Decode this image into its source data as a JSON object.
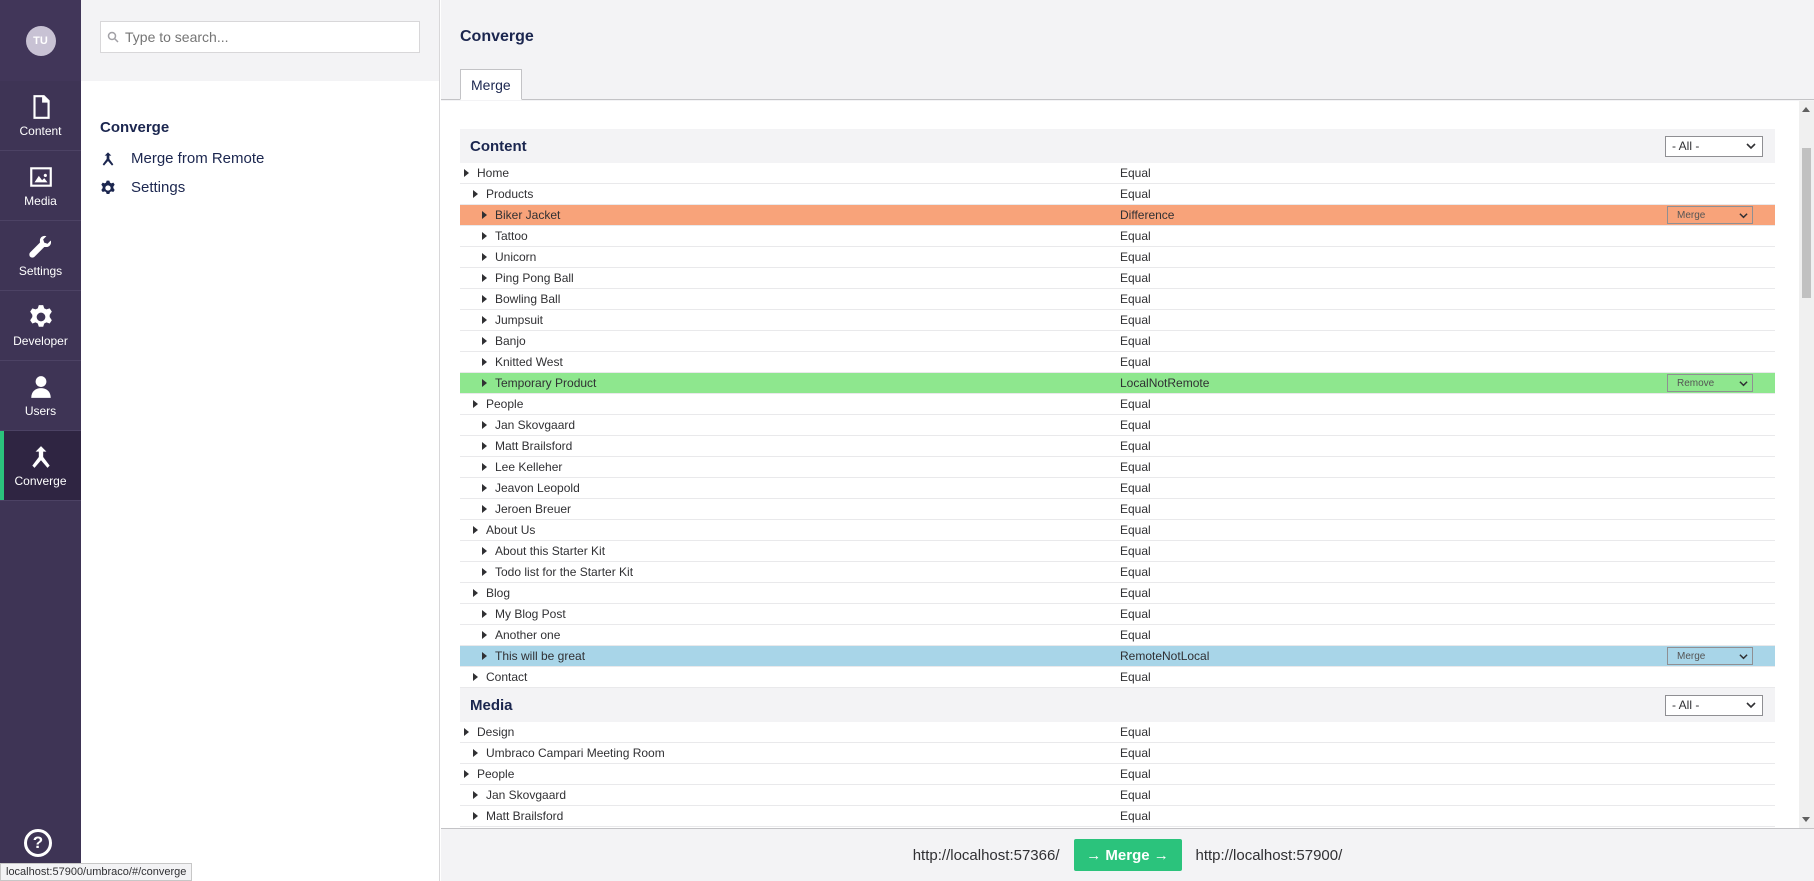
{
  "user": {
    "initials": "TU"
  },
  "nav": {
    "items": [
      {
        "label": "Content",
        "icon": "document-icon"
      },
      {
        "label": "Media",
        "icon": "image-icon"
      },
      {
        "label": "Settings",
        "icon": "wrench-icon"
      },
      {
        "label": "Developer",
        "icon": "gear-icon"
      },
      {
        "label": "Users",
        "icon": "user-icon"
      },
      {
        "label": "Converge",
        "icon": "merge-icon"
      }
    ],
    "help_label": "?"
  },
  "tree": {
    "search_placeholder": "Type to search...",
    "title": "Converge",
    "items": [
      {
        "label": "Merge from Remote",
        "icon": "merge-icon"
      },
      {
        "label": "Settings",
        "icon": "gear-icon"
      }
    ]
  },
  "header": {
    "title": "Converge",
    "tab": "Merge"
  },
  "sections": {
    "content": {
      "name": "Content",
      "filter": "- All -",
      "rows": [
        {
          "name": "Home",
          "status": "Equal"
        },
        {
          "name": "Products",
          "status": "Equal"
        },
        {
          "name": "Biker Jacket",
          "status": "Difference",
          "action": "Merge"
        },
        {
          "name": "Tattoo",
          "status": "Equal"
        },
        {
          "name": "Unicorn",
          "status": "Equal"
        },
        {
          "name": "Ping Pong Ball",
          "status": "Equal"
        },
        {
          "name": "Bowling Ball",
          "status": "Equal"
        },
        {
          "name": "Jumpsuit",
          "status": "Equal"
        },
        {
          "name": "Banjo",
          "status": "Equal"
        },
        {
          "name": "Knitted West",
          "status": "Equal"
        },
        {
          "name": "Temporary Product",
          "status": "LocalNotRemote",
          "action": "Remove"
        },
        {
          "name": "People",
          "status": "Equal"
        },
        {
          "name": "Jan Skovgaard",
          "status": "Equal"
        },
        {
          "name": "Matt Brailsford",
          "status": "Equal"
        },
        {
          "name": "Lee Kelleher",
          "status": "Equal"
        },
        {
          "name": "Jeavon Leopold",
          "status": "Equal"
        },
        {
          "name": "Jeroen Breuer",
          "status": "Equal"
        },
        {
          "name": "About Us",
          "status": "Equal"
        },
        {
          "name": "About this Starter Kit",
          "status": "Equal"
        },
        {
          "name": "Todo list for the Starter Kit",
          "status": "Equal"
        },
        {
          "name": "Blog",
          "status": "Equal"
        },
        {
          "name": "My Blog Post",
          "status": "Equal"
        },
        {
          "name": "Another one",
          "status": "Equal"
        },
        {
          "name": "This will be great",
          "status": "RemoteNotLocal",
          "action": "Merge"
        },
        {
          "name": "Contact",
          "status": "Equal"
        }
      ]
    },
    "media": {
      "name": "Media",
      "filter": "- All -",
      "rows": [
        {
          "name": "Design",
          "status": "Equal"
        },
        {
          "name": "Umbraco Campari Meeting Room",
          "status": "Equal"
        },
        {
          "name": "People",
          "status": "Equal"
        },
        {
          "name": "Jan Skovgaard",
          "status": "Equal"
        },
        {
          "name": "Matt Brailsford",
          "status": "Equal"
        }
      ]
    }
  },
  "footer": {
    "source_url": "http://localhost:57366/",
    "merge_label": "→ Merge →",
    "target_url": "http://localhost:57900/"
  },
  "status_bar": {
    "url": "localhost:57900/umbraco/#/converge"
  },
  "colors": {
    "nav_bg": "#3e3455",
    "accent": "#2bc37c",
    "difference": "#f8a37a",
    "local_not_remote": "#8ee78e",
    "remote_not_local": "#a8d5e8"
  }
}
